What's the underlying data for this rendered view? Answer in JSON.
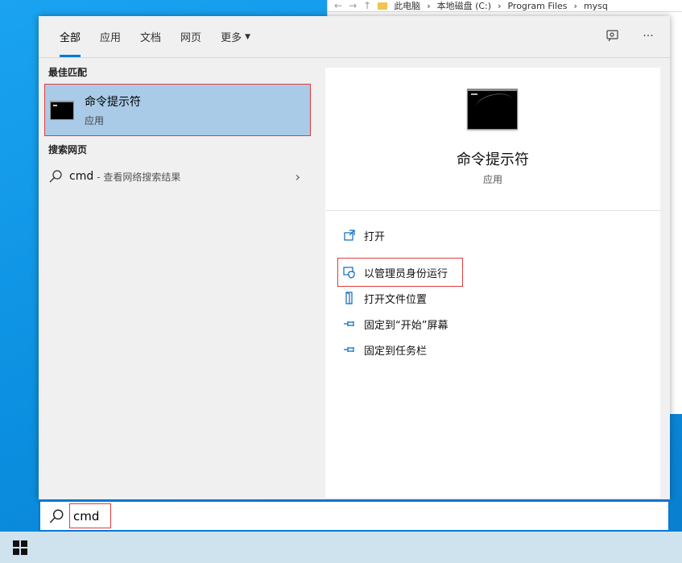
{
  "explorer": {
    "breadcrumb": [
      "此电脑",
      "本地磁盘 (C:)",
      "Program Files",
      "mysq"
    ]
  },
  "tabs": [
    {
      "label": "全部",
      "active": true
    },
    {
      "label": "应用"
    },
    {
      "label": "文档"
    },
    {
      "label": "网页"
    },
    {
      "label": "更多"
    }
  ],
  "left": {
    "best_match_title": "最佳匹配",
    "best_match": {
      "name": "命令提示符",
      "type": "应用"
    },
    "web_title": "搜索网页",
    "web_result": {
      "query": "cmd",
      "hint": "- 查看网络搜索结果"
    }
  },
  "detail": {
    "name": "命令提示符",
    "type": "应用",
    "actions": [
      {
        "label": "打开",
        "icon": "open-icon"
      },
      {
        "label": "以管理员身份运行",
        "icon": "admin-shield-icon"
      },
      {
        "label": "打开文件位置",
        "icon": "file-location-icon"
      },
      {
        "label": "固定到“开始”屏幕",
        "icon": "pin-icon"
      },
      {
        "label": "固定到任务栏",
        "icon": "pin-icon"
      }
    ]
  },
  "search": {
    "value": "cmd"
  },
  "colors": {
    "accent": "#0078d7",
    "highlight": "#a9cbe8",
    "annotation": "#e23b3b"
  }
}
